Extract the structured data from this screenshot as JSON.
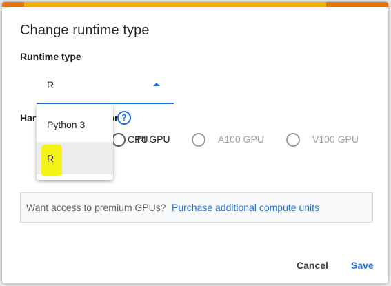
{
  "dialog": {
    "title": "Change runtime type",
    "runtime_type_label": "Runtime type",
    "runtime_select": {
      "value": "R",
      "options": [
        "Python 3",
        "R"
      ],
      "selected": "R"
    },
    "hardware_label": "Hardware accelerator",
    "hardware_options": [
      {
        "label": "CPU",
        "selected": false,
        "enabled": true
      },
      {
        "label": "T4 GPU",
        "selected": false,
        "enabled": true
      },
      {
        "label": "A100 GPU",
        "selected": false,
        "enabled": false
      },
      {
        "label": "V100 GPU",
        "selected": false,
        "enabled": false
      }
    ],
    "premium_message": "Want access to premium GPUs?",
    "premium_link": "Purchase additional compute units",
    "cancel_label": "Cancel",
    "save_label": "Save"
  },
  "colors": {
    "accent_orange": "#f9ab00",
    "accent_dark_orange": "#e8710a",
    "primary_blue": "#1a73e8",
    "highlight_yellow": "#f4f400"
  },
  "icons": {
    "help": "help-circle-icon",
    "dropdown_arrow": "caret-up-icon"
  }
}
